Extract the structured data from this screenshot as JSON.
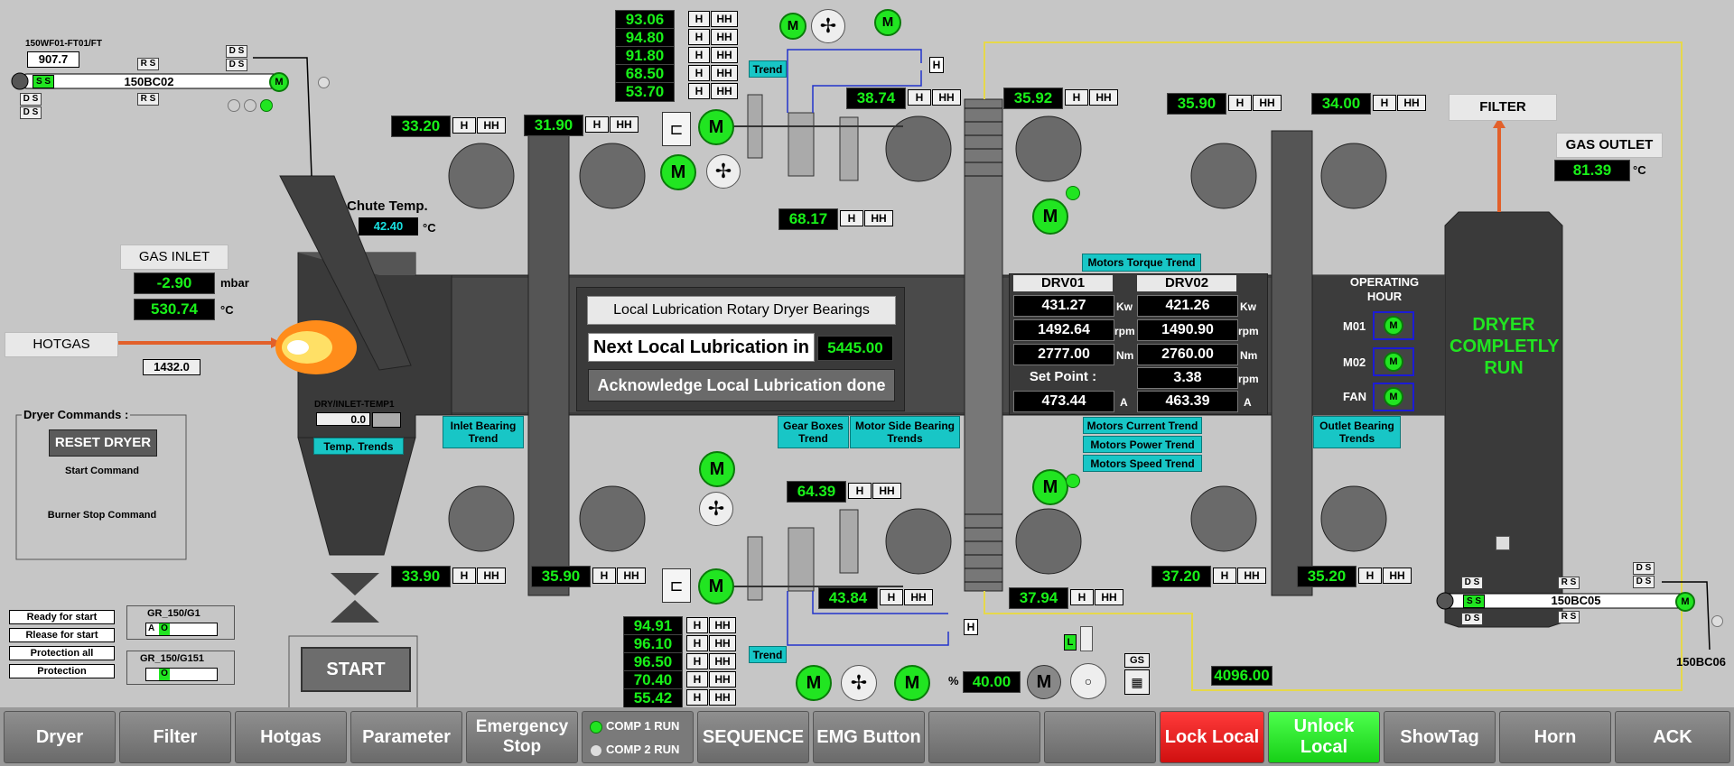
{
  "colors": {
    "value_green": "#19f019",
    "motor_green": "#21e521",
    "trend_cyan": "#18c6c6",
    "pipe_orange": "#e2602a",
    "lock_red": "#e81c1c",
    "unlock_green": "#2ee82e",
    "conveyor_yellow": "#e6d84a"
  },
  "flow_meter": {
    "tag": "150WF01-FT01/FT",
    "value": "907.7"
  },
  "conveyor_left": {
    "name": "150BC02",
    "ss": "S S",
    "rs": "R S",
    "ds": "D S"
  },
  "conveyor_right": {
    "name": "150BC05",
    "ss": "S S",
    "rs": "R S",
    "ds": "D S"
  },
  "bc06": {
    "name": "150BC06"
  },
  "gas_inlet": {
    "title": "GAS INLET",
    "pressure": "-2.90",
    "pressure_unit": "mbar",
    "temp": "530.74",
    "temp_unit": "°C"
  },
  "hotgas": {
    "label": "HOTGAS",
    "value": "1432.0"
  },
  "chute": {
    "label": "Chute Temp.",
    "value": "42.40",
    "unit": "°C"
  },
  "dry_inlet": {
    "label": "DRY/INLET-TEMP1",
    "value": "0.0",
    "trend": "Temp. Trends"
  },
  "dryer_commands": {
    "title": "Dryer Commands :",
    "reset": "RESET DRYER",
    "start_cmd": "Start Command",
    "burner_stop": "Burner Stop Command"
  },
  "status_list": [
    "Ready for start",
    "Rlease for start",
    "Protection all",
    "Protection"
  ],
  "gr1": {
    "label": "GR_150/G1",
    "a": "A",
    "o": "O"
  },
  "gr2": {
    "label": "GR_150/G151",
    "o": "O"
  },
  "start_button": "START",
  "alarm": {
    "h": "H",
    "hh": "HH"
  },
  "temps_top_stack": [
    "93.06",
    "94.80",
    "91.80",
    "68.50",
    "53.70"
  ],
  "temps_bottom_stack": [
    "94.91",
    "96.10",
    "96.50",
    "70.40",
    "55.42"
  ],
  "bearing_temps": {
    "t1": "33.20",
    "t2": "31.90",
    "t3": "38.74",
    "t4": "35.92",
    "t5": "35.90",
    "t6": "34.00",
    "t7": "68.17",
    "t8": "33.90",
    "t9": "35.90",
    "t10": "64.39",
    "t11": "43.84",
    "t12": "37.94",
    "t13": "37.20",
    "t14": "35.20"
  },
  "trend_labels": {
    "trend": "Trend",
    "inlet": "Inlet Bearing Trend",
    "gear": "Gear Boxes Trend",
    "motor_side": "Motor Side Bearing Trends",
    "outlet": "Outlet Bearing Trends",
    "torque": "Motors Torque Trend",
    "current": "Motors Current Trend",
    "power": "Motors Power Trend",
    "speed": "Motors Speed Trend"
  },
  "lubrication": {
    "title": "Local Lubrication Rotary Dryer Bearings",
    "next_label": "Next Local Lubrication in",
    "next_value": "5445.00",
    "ack": "Acknowledge Local Lubrication done"
  },
  "drives": {
    "drv01": "DRV01",
    "drv02": "DRV02",
    "kw1": "431.27",
    "kw2": "421.26",
    "rpm1": "1492.64",
    "rpm2": "1490.90",
    "nm1": "2777.00",
    "nm2": "2760.00",
    "setpoint_label": "Set Point :",
    "setpoint": "3.38",
    "a1": "473.44",
    "a2": "463.39",
    "u_kw": "Kw",
    "u_rpm": "rpm",
    "u_nm": "Nm",
    "u_a": "A"
  },
  "operating_hour": {
    "title": "OPERATING HOUR",
    "m01": "M01",
    "m02": "M02",
    "fan": "FAN"
  },
  "dryer_status": "DRYER COMPLETLY RUN",
  "filter": "FILTER",
  "gas_outlet": {
    "label": "GAS OUTLET",
    "value": "81.39",
    "unit": "°C"
  },
  "valve": {
    "pct": "%",
    "value": "40.00",
    "gs": "GS",
    "l": "L",
    "out": "4096.00"
  },
  "motor_label": "M",
  "bottom_buttons": {
    "dryer": "Dryer",
    "filter": "Filter",
    "hotgas": "Hotgas",
    "parameter": "Parameter",
    "emergency": "Emergency Stop",
    "comp1": "COMP 1 RUN",
    "comp2": "COMP 2 RUN",
    "sequence": "SEQUENCE",
    "emg": "EMG Button",
    "lock": "Lock Local",
    "unlock": "Unlock Local",
    "showtag": "ShowTag",
    "horn": "Horn",
    "ack": "ACK"
  }
}
